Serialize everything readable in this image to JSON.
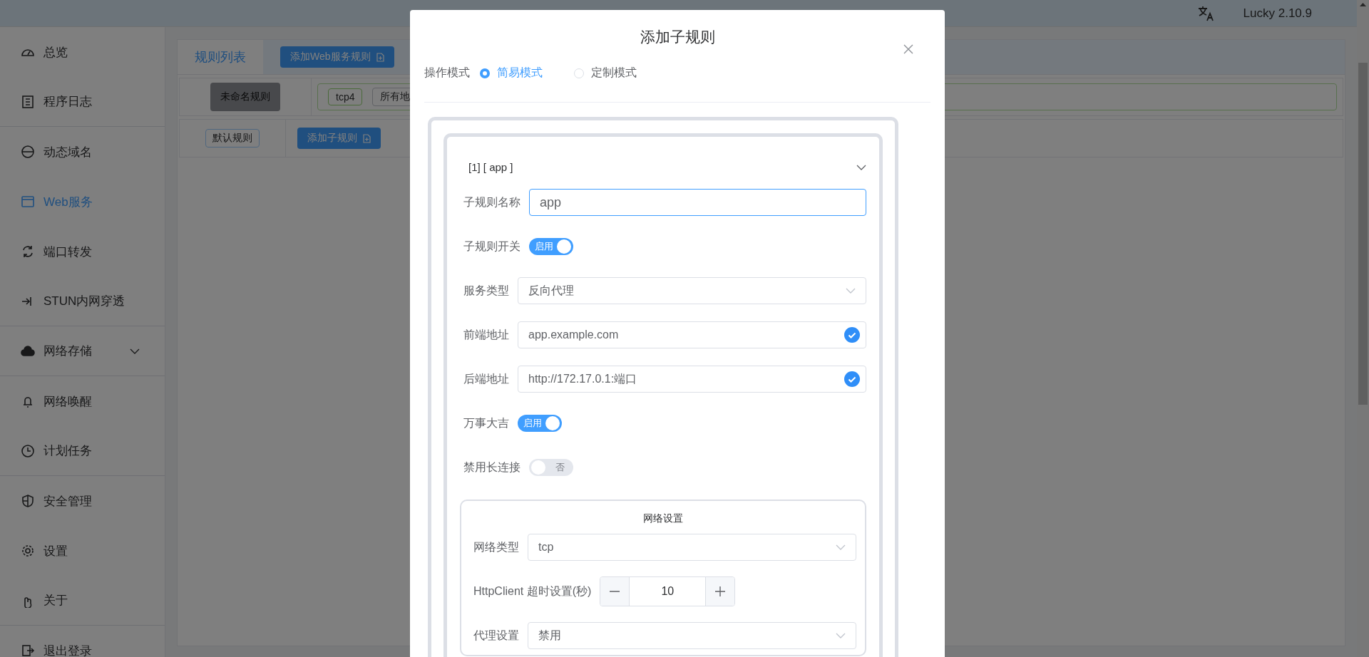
{
  "top_bar": {
    "version": "Lucky 2.10.9"
  },
  "sidebar": {
    "items": [
      {
        "label": "总览",
        "selected": false,
        "kind": "link"
      },
      {
        "label": "程序日志",
        "selected": false,
        "kind": "link"
      },
      {
        "label": "动态域名",
        "selected": false,
        "kind": "link"
      },
      {
        "label": "Web服务",
        "selected": true,
        "kind": "link"
      },
      {
        "label": "端口转发",
        "selected": false,
        "kind": "link"
      },
      {
        "label": "STUN内网穿透",
        "selected": false,
        "kind": "link"
      },
      {
        "label": "网络存储",
        "selected": false,
        "kind": "submenu"
      },
      {
        "label": "网络唤醒",
        "selected": false,
        "kind": "link"
      },
      {
        "label": "计划任务",
        "selected": false,
        "kind": "link"
      },
      {
        "label": "安全管理",
        "selected": false,
        "kind": "link"
      },
      {
        "label": "设置",
        "selected": false,
        "kind": "link"
      },
      {
        "label": "关于",
        "selected": false,
        "kind": "link"
      },
      {
        "label": "退出登录",
        "selected": false,
        "kind": "link"
      }
    ]
  },
  "rules_panel": {
    "tabs": [
      {
        "label": "规则列表",
        "selected": true
      }
    ],
    "add_button": "添加Web服务规则",
    "rows": [
      {
        "kind": "rule",
        "name": "未命名规则",
        "tags": [
          "tcp4",
          "所有地"
        ]
      },
      {
        "kind": "default",
        "name": "默认规则",
        "button": "添加子规则"
      }
    ]
  },
  "dialog": {
    "title": "添加子规则",
    "mode_label": "操作模式",
    "modes": [
      {
        "label": "简易模式",
        "selected": true
      },
      {
        "label": "定制模式",
        "selected": false
      }
    ],
    "subrule": {
      "header": "[1] [ app ]",
      "fields": [
        {
          "kind": "text",
          "label": "子规则名称",
          "value": "app",
          "focused": true
        },
        {
          "kind": "switch",
          "label": "子规则开关",
          "on": true,
          "text": "启用"
        },
        {
          "kind": "select",
          "label": "服务类型",
          "value": "反向代理"
        },
        {
          "kind": "address",
          "label": "前端地址",
          "value": "app.example.com",
          "valid": true
        },
        {
          "kind": "address",
          "label": "后端地址",
          "value": "http://172.17.0.1:端口",
          "valid": true
        },
        {
          "kind": "switch",
          "label": "万事大吉",
          "on": true,
          "text": "启用"
        },
        {
          "kind": "switch",
          "label": "禁用长连接",
          "on": false,
          "text": "否"
        }
      ],
      "network": {
        "title": "网络设置",
        "fields": [
          {
            "kind": "select",
            "label": "网络类型",
            "value": "tcp"
          },
          {
            "kind": "stepper",
            "label": "HttpClient 超时设置(秒)",
            "value": "10"
          },
          {
            "kind": "select",
            "label": "代理设置",
            "value": "禁用"
          }
        ]
      }
    }
  }
}
